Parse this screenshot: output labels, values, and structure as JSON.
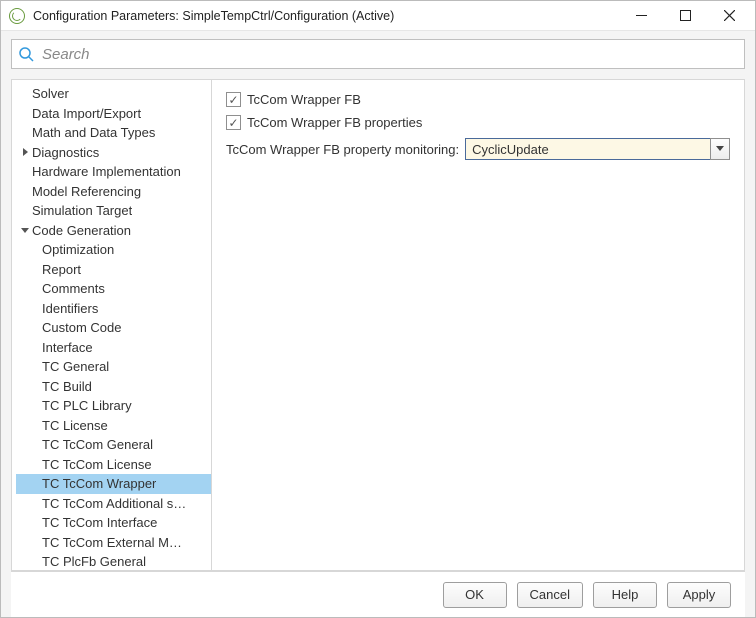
{
  "window": {
    "title": "Configuration Parameters: SimpleTempCtrl/Configuration (Active)"
  },
  "search": {
    "placeholder": "Search"
  },
  "tree": {
    "items": [
      {
        "label": "Solver",
        "depth": 0,
        "expandable": false
      },
      {
        "label": "Data Import/Export",
        "depth": 0,
        "expandable": false
      },
      {
        "label": "Math and Data Types",
        "depth": 0,
        "expandable": false
      },
      {
        "label": "Diagnostics",
        "depth": 0,
        "expandable": true,
        "expanded": false
      },
      {
        "label": "Hardware Implementation",
        "depth": 0,
        "expandable": false
      },
      {
        "label": "Model Referencing",
        "depth": 0,
        "expandable": false
      },
      {
        "label": "Simulation Target",
        "depth": 0,
        "expandable": false
      },
      {
        "label": "Code Generation",
        "depth": 0,
        "expandable": true,
        "expanded": true
      },
      {
        "label": "Optimization",
        "depth": 1
      },
      {
        "label": "Report",
        "depth": 1
      },
      {
        "label": "Comments",
        "depth": 1
      },
      {
        "label": "Identifiers",
        "depth": 1
      },
      {
        "label": "Custom Code",
        "depth": 1
      },
      {
        "label": "Interface",
        "depth": 1
      },
      {
        "label": "TC General",
        "depth": 1
      },
      {
        "label": "TC Build",
        "depth": 1
      },
      {
        "label": "TC PLC Library",
        "depth": 1
      },
      {
        "label": "TC License",
        "depth": 1
      },
      {
        "label": "TC TcCom General",
        "depth": 1
      },
      {
        "label": "TC TcCom License",
        "depth": 1
      },
      {
        "label": "TC TcCom Wrapper",
        "depth": 1,
        "selected": true
      },
      {
        "label": "TC TcCom Additional s…",
        "depth": 1
      },
      {
        "label": "TC TcCom Interface",
        "depth": 1
      },
      {
        "label": "TC TcCom External M…",
        "depth": 1
      },
      {
        "label": "TC PlcFb General",
        "depth": 1
      }
    ]
  },
  "panel": {
    "chk1": {
      "label": "TcCom Wrapper FB",
      "checked": true
    },
    "chk2": {
      "label": "TcCom Wrapper FB properties",
      "checked": true
    },
    "combo": {
      "label": "TcCom Wrapper FB property monitoring:",
      "value": "CyclicUpdate"
    }
  },
  "footer": {
    "ok": "OK",
    "cancel": "Cancel",
    "help": "Help",
    "apply": "Apply"
  }
}
